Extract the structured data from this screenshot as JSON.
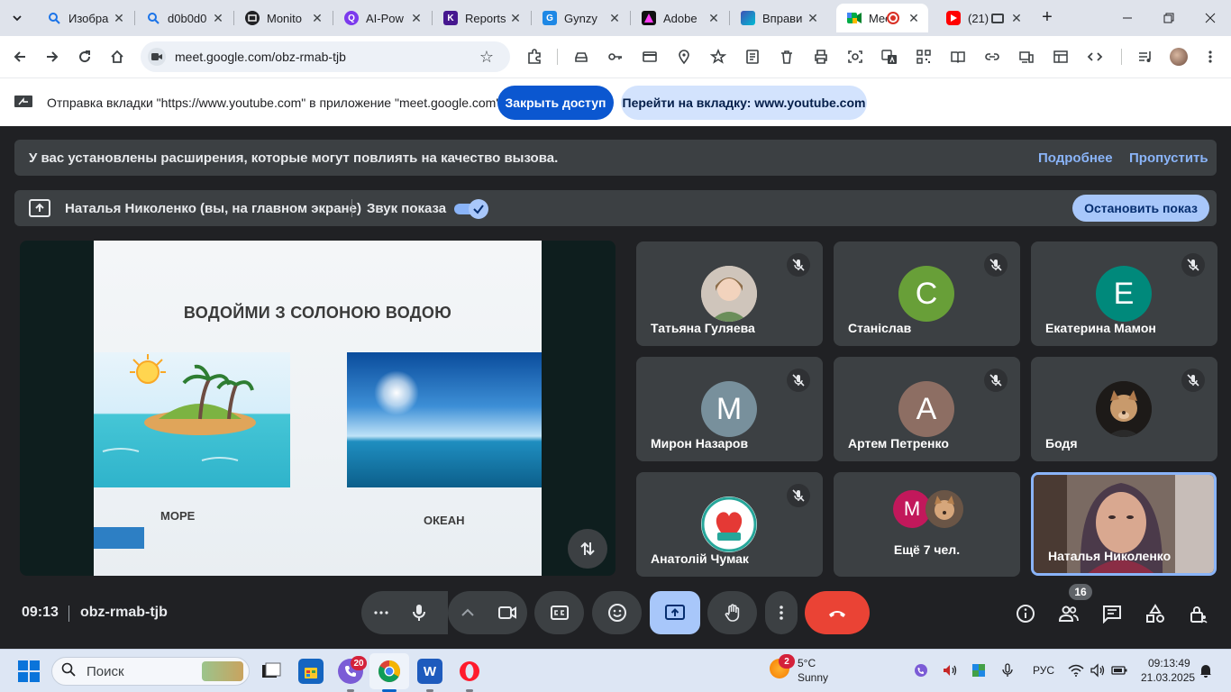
{
  "browser": {
    "tabs": [
      {
        "title": "Изобра",
        "favicon_color": "#1a73e8",
        "favicon": "search-icon"
      },
      {
        "title": "d0b0d0",
        "favicon_color": "#1a73e8",
        "favicon": "search-icon"
      },
      {
        "title": "Monito",
        "favicon_color": "#202124",
        "favicon": "monitor-icon"
      },
      {
        "title": "AI-Pow",
        "favicon_color": "#7c3aed",
        "favicon": "q-icon"
      },
      {
        "title": "Reports",
        "favicon_color": "#46178f",
        "favicon": "kahoot-icon"
      },
      {
        "title": "Gynzy",
        "favicon_color": "#1e88e5",
        "favicon": "gynzy-icon"
      },
      {
        "title": "Adobe",
        "favicon_color": "#111111",
        "favicon": "adobe-icon"
      },
      {
        "title": "Вправи",
        "favicon_color": "#3f51b5",
        "favicon": "exercises-icon"
      },
      {
        "title": "Mee",
        "favicon_color": "#00ac47",
        "favicon": "meet-icon"
      },
      {
        "title": "(21)",
        "favicon_color": "#ff0000",
        "favicon": "youtube-icon"
      }
    ],
    "address": "meet.google.com/obz-rmab-tjb"
  },
  "infobar": {
    "message": "Отправка вкладки \"https://www.youtube.com\" в приложение \"meet.google.com\"...",
    "stop_sharing": "Закрыть доступ",
    "goto_tab": "Перейти на вкладку: www.youtube.com"
  },
  "meet": {
    "extensions_banner": {
      "message": "У вас установлены расширения, которые могут повлиять на качество вызова.",
      "learn_more": "Подробнее",
      "skip": "Пропустить"
    },
    "presenting_banner": {
      "presenter": "Наталья Николенко (вы, на главном экране)",
      "share_audio": "Звук показа",
      "stop": "Остановить показ"
    },
    "slide": {
      "title": "ВОДОЙМИ З СОЛОНОЮ ВОДОЮ",
      "left_caption": "МОРЕ",
      "right_caption": "ОКЕАН"
    },
    "participants": [
      {
        "name": "Татьяна Гуляева",
        "initial": "",
        "color": "#d7c3b0",
        "muted": true
      },
      {
        "name": "Станіслав",
        "initial": "С",
        "color": "#689f38",
        "muted": true
      },
      {
        "name": "Екатерина Мамон",
        "initial": "Е",
        "color": "#00897b",
        "muted": true
      },
      {
        "name": "Мирон Назаров",
        "initial": "М",
        "color": "#78909c",
        "muted": true
      },
      {
        "name": "Артем Петренко",
        "initial": "А",
        "color": "#8d6e63",
        "muted": true
      },
      {
        "name": "Бодя",
        "initial": "",
        "color": "#2b2522",
        "muted": true
      },
      {
        "name": "Анатолій Чумак",
        "initial": "",
        "color": "#ffffff",
        "muted": true
      }
    ],
    "more_tile": {
      "label": "Ещё 7 чел.",
      "initial": "М",
      "color": "#c2185b"
    },
    "self_tile": {
      "name": "Наталья Николенко"
    },
    "bottom": {
      "time": "09:13",
      "meeting_code": "obz-rmab-tjb",
      "participants_count": "16"
    }
  },
  "taskbar": {
    "search_placeholder": "Поиск",
    "viber_badge": "20",
    "weather_badge": "2",
    "weather_temp": "5°C",
    "weather_cond": "Sunny",
    "language": "РУС",
    "time": "09:13:49",
    "date": "21.03.2025"
  }
}
